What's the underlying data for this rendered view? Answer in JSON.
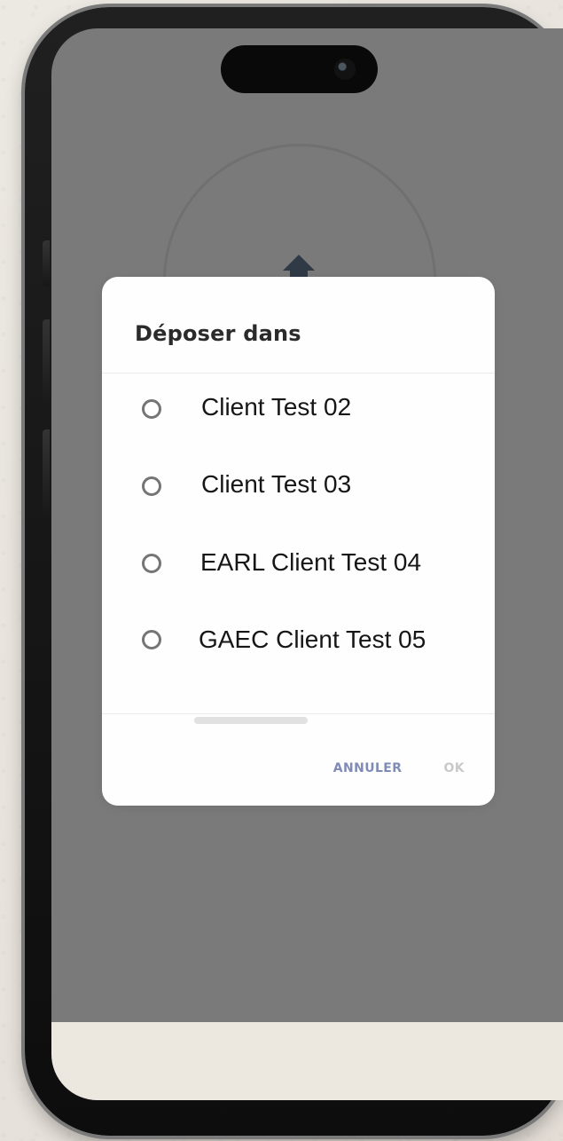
{
  "dialog": {
    "title": "Déposer dans",
    "options": [
      {
        "label": "Client Test 02"
      },
      {
        "label": "Client Test 03"
      },
      {
        "label": "EARL Client Test 04"
      },
      {
        "label": "GAEC Client Test 05"
      }
    ],
    "actions": {
      "cancel_label": "ANNULER",
      "ok_label": "OK"
    }
  },
  "icons": {
    "background": "upload-arrow-icon",
    "radio": "radio-button-icon"
  },
  "colors": {
    "overlay": "#7a7a7a",
    "accent": "#7f8ab6",
    "disabled": "#c9c9c9",
    "radio": "#757575",
    "dialog": "#fefefe"
  }
}
